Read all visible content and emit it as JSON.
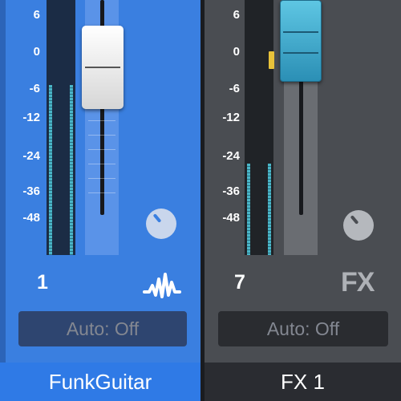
{
  "colors": {
    "channel1_bg": "#3a7fe0",
    "channel2_bg": "#4a4d52",
    "meter_level": "#4ab6c8",
    "fader1_cap": "#ffffff",
    "fader2_cap": "#4bb3d6",
    "peak_marker": "#e8c23a"
  },
  "scale_labels": [
    "6",
    "0",
    "-6",
    "-12",
    "-24",
    "-36",
    "-48"
  ],
  "channels": [
    {
      "number": "1",
      "name": "FunkGuitar",
      "automation_label": "Auto: Off",
      "type_icon": "waveform-icon",
      "selected": true,
      "meter_level_db": -6,
      "fader_db": 0
    },
    {
      "number": "7",
      "name": "FX 1",
      "automation_label": "Auto: Off",
      "type_label": "FX",
      "selected": false,
      "meter_level_db": -24,
      "fader_db": 3
    }
  ]
}
